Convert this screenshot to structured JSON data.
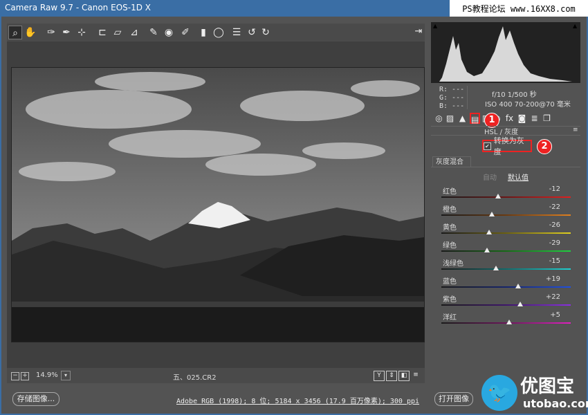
{
  "window": {
    "title": "Camera Raw 9.7  -  Canon EOS-1D X",
    "watermark_top": "PS教程论坛 www.16XX8.com"
  },
  "toolbar": {
    "tools": [
      {
        "name": "zoom-icon",
        "glyph": "⌕"
      },
      {
        "name": "hand-icon",
        "glyph": "✋"
      },
      {
        "name": "white-balance-icon",
        "glyph": "✑"
      },
      {
        "name": "color-sampler-icon",
        "glyph": "✒"
      },
      {
        "name": "target-adjust-icon",
        "glyph": "⊹"
      },
      {
        "name": "crop-icon",
        "glyph": "⊏"
      },
      {
        "name": "straighten-icon",
        "glyph": "⏥"
      },
      {
        "name": "transform-icon",
        "glyph": "⊿"
      },
      {
        "name": "spot-removal-icon",
        "glyph": "✎"
      },
      {
        "name": "red-eye-icon",
        "glyph": "◉"
      },
      {
        "name": "brush-icon",
        "glyph": "✐"
      },
      {
        "name": "graduated-filter-icon",
        "glyph": "▮"
      },
      {
        "name": "radial-filter-icon",
        "glyph": "◯"
      },
      {
        "name": "preferences-icon",
        "glyph": "☰"
      },
      {
        "name": "rotate-ccw-icon",
        "glyph": "↺"
      },
      {
        "name": "rotate-cw-icon",
        "glyph": "↻"
      }
    ],
    "export_glyph": "⇥"
  },
  "status": {
    "zoom": "14.9%",
    "filename": "五、025.CR2",
    "zoom_out": "−",
    "zoom_in": "+",
    "dropdown": "▾",
    "view_buttons": [
      "Y",
      "⇕",
      "◧",
      "≡"
    ]
  },
  "footer": {
    "save_button": "存储图像...",
    "workflow_link": "Adobe RGB (1998); 8 位; 5184 x 3456 (17.9 百万像素); 300 ppi",
    "open_button": "打开图像"
  },
  "logo": {
    "chinese": "优图宝",
    "domain": "utobao.com",
    "badge_glyph": "🐦"
  },
  "info": {
    "r": "R:  ---",
    "g": "G:  ---",
    "b": "B:  ---",
    "aperture_shutter": "f/10   1/500 秒",
    "iso_lens": "ISO 400   70-200@70 毫米"
  },
  "panel": {
    "tabs": [
      {
        "name": "basic-tab-icon",
        "glyph": "◎"
      },
      {
        "name": "tone-curve-tab-icon",
        "glyph": "▨"
      },
      {
        "name": "detail-tab-icon",
        "glyph": "▲"
      },
      {
        "name": "hsl-tab-icon",
        "glyph": "▤"
      },
      {
        "name": "split-toning-tab-icon",
        "glyph": "▥"
      },
      {
        "name": "lens-tab-icon",
        "glyph": "◐"
      },
      {
        "name": "fx-tab-icon",
        "glyph": "fx"
      },
      {
        "name": "camera-calibration-tab-icon",
        "glyph": "◙"
      },
      {
        "name": "presets-tab-icon",
        "glyph": "≣"
      },
      {
        "name": "snapshots-tab-icon",
        "glyph": "❐"
      }
    ],
    "title": "HSL / 灰度",
    "convert_label": "转换为灰度",
    "convert_checked": "✔",
    "subtab": "灰度混合",
    "auto": "自动",
    "default": "默认值",
    "menu_glyph": "≡"
  },
  "annotations": {
    "marker1": "1",
    "marker2": "2"
  },
  "sliders": [
    {
      "label": "红色",
      "value": "-12",
      "v": -12,
      "colors": [
        "#1a1a1a",
        "#6b1616",
        "#e02020"
      ]
    },
    {
      "label": "橙色",
      "value": "-22",
      "v": -22,
      "colors": [
        "#1a1a1a",
        "#6b3a10",
        "#e08020"
      ]
    },
    {
      "label": "黄色",
      "value": "-26",
      "v": -26,
      "colors": [
        "#1a1a1a",
        "#6b6010",
        "#e0d020"
      ]
    },
    {
      "label": "绿色",
      "value": "-29",
      "v": -29,
      "colors": [
        "#1a1a1a",
        "#176b17",
        "#20d040"
      ]
    },
    {
      "label": "浅绿色",
      "value": "-15",
      "v": -15,
      "colors": [
        "#1a1a1a",
        "#106b6b",
        "#20d0d0"
      ]
    },
    {
      "label": "蓝色",
      "value": "+19",
      "v": 19,
      "colors": [
        "#1a1a1a",
        "#16246b",
        "#2050e0"
      ]
    },
    {
      "label": "紫色",
      "value": "+22",
      "v": 22,
      "colors": [
        "#1a1a1a",
        "#3e166b",
        "#8a30e0"
      ]
    },
    {
      "label": "洋红",
      "value": "+5",
      "v": 5,
      "colors": [
        "#1a1a1a",
        "#6b165a",
        "#e020c0"
      ]
    }
  ]
}
